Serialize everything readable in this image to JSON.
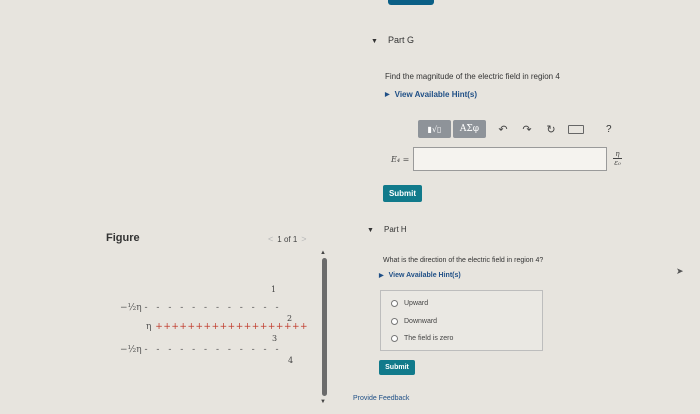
{
  "figure": {
    "title": "Figure",
    "pager": {
      "prev": "<",
      "text": "1 of 1",
      "next": ">"
    },
    "scroll": {
      "up": "▲",
      "down": "▼"
    },
    "rows": {
      "neg1": {
        "label": "−½η",
        "dashes": "- - - - - - - - - - - -"
      },
      "pos": {
        "label": "η",
        "pluses": "+++++++++++++++++++"
      },
      "neg2": {
        "label": "−½η",
        "dashes": "- - - - - - - - - - - -"
      }
    },
    "regions": [
      "1",
      "2",
      "3",
      "4"
    ]
  },
  "partG": {
    "caret": "▼",
    "title": "Part G",
    "question": "Find the magnitude of the electric field in region 4",
    "hint": "View Available Hint(s)",
    "toolbar": {
      "template_label": "▮√▯",
      "greek_label": "ΑΣφ",
      "undo": "↶",
      "redo": "↷",
      "reset": "↻",
      "help": "?"
    },
    "input_label": "E₄ =",
    "input_value": "",
    "unit": {
      "num": "η",
      "den": "ε₀"
    },
    "submit": "Submit"
  },
  "partH": {
    "caret": "▼",
    "title": "Part H",
    "question": "What is the direction of the electric field in region 4?",
    "hint": "View Available Hint(s)",
    "options": [
      "Upward",
      "Downward",
      "The field is zero"
    ],
    "submit": "Submit"
  },
  "feedback": "Provide Feedback"
}
